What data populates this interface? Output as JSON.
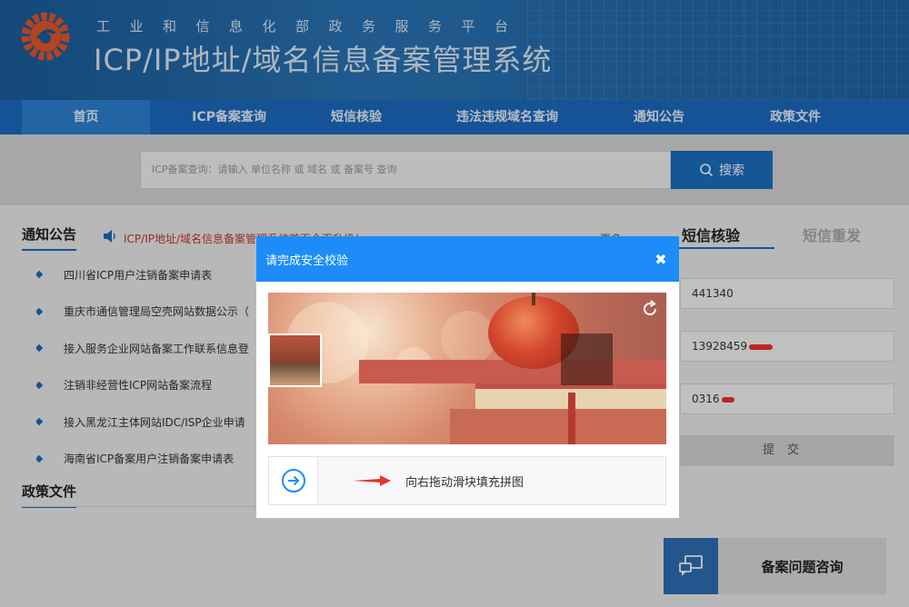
{
  "header": {
    "platform_name": "工业和信息化部政务服务平台",
    "system_title": "ICP/IP地址/域名信息备案管理系统"
  },
  "nav": {
    "items": [
      {
        "label": "首页",
        "active": true
      },
      {
        "label": "ICP备案查询"
      },
      {
        "label": "短信核验"
      },
      {
        "label": "违法违规域名查询"
      },
      {
        "label": "通知公告"
      },
      {
        "label": "政策文件"
      }
    ]
  },
  "search": {
    "placeholder": "ICP备案查询：请输入 单位名称 或 域名 或 备案号 查询",
    "button_label": "搜索"
  },
  "notice": {
    "title": "通知公告",
    "marquee": "ICP/IP地址/域名信息备案管理系统首页全面升级！",
    "more": "更多 ›",
    "items": [
      "四川省ICP用户注销备案申请表",
      "重庆市通信管理局空壳网站数据公示（",
      "接入服务企业网站备案工作联系信息登",
      "注销非经营性ICP网站备案流程",
      "接入黑龙江主体网站IDC/ISP企业申请",
      "海南省ICP备案用户注销备案申请表"
    ]
  },
  "policy": {
    "title": "政策文件"
  },
  "sms": {
    "tab_verify": "短信核验",
    "tab_resend": "短信重发",
    "field1": "441340",
    "field2": "13928459",
    "field3": "0316",
    "submit": "提交"
  },
  "consult": {
    "label": "备案问题咨询"
  },
  "modal": {
    "title": "请完成安全校验",
    "close": "✖",
    "slider_hint": "向右拖动滑块填充拼图"
  }
}
